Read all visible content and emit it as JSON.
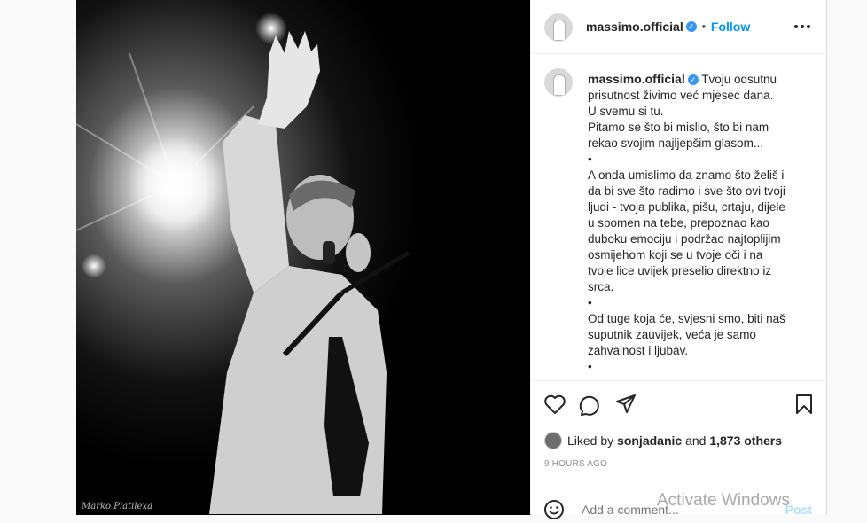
{
  "post": {
    "image_alt": "Black and white photo of a singer on stage with raised hand and microphone",
    "photo_signature": "Marko Platilexa"
  },
  "header": {
    "username": "massimo.official",
    "separator": "•",
    "follow_label": "Follow"
  },
  "caption": {
    "username": "massimo.official",
    "lines": [
      "Tvoju odsutnu",
      "prisutnost živimo već mjesec dana.",
      "U svemu si tu.",
      "Pitamo se što bi mislio, što bi nam",
      "rekao svojim najljepšim glasom...",
      "•",
      "A onda umislimo da znamo što želiš i",
      "da bi sve što radimo i sve što ovi tvoji",
      "ljudi - tvoja publika, pišu, crtaju, dijele",
      "u spomen na tebe, prepoznao kao",
      "duboku emociju i podržao najtoplijim",
      "osmijehom koji se u tvoje oči i na",
      "tvoje lice uvijek preselio direktno iz",
      "srca.",
      "•",
      "Od tuge koja će, svjesni smo, biti naš",
      "suputnik zauvijek, veća je samo",
      "zahvalnost i ljubav.",
      "•"
    ]
  },
  "actions": {
    "icons": [
      "heart-icon",
      "comment-icon",
      "share-icon",
      "bookmark-icon"
    ]
  },
  "likes": {
    "prefix": "Liked by",
    "user": "sonjadanic",
    "conj": "and",
    "others": "1,873 others"
  },
  "timestamp": "9 HOURS AGO",
  "comment": {
    "placeholder": "Add a comment...",
    "post_label": "Post"
  },
  "os_watermark": "Activate Windows",
  "colors": {
    "link_blue": "#0095f6",
    "verified_blue": "#3897f0",
    "post_disabled": "#b2dffc"
  }
}
